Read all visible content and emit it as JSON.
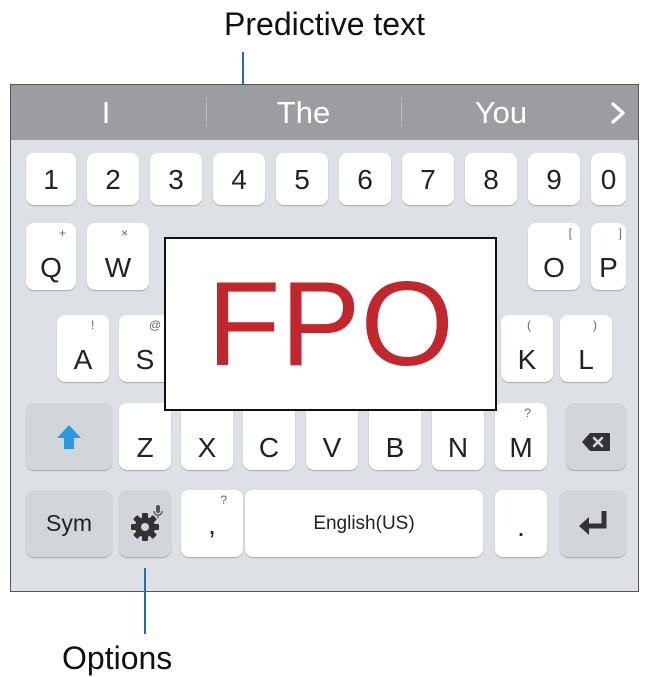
{
  "callouts": {
    "top": "Predictive text",
    "bottom": "Options"
  },
  "suggestions": [
    "I",
    "The",
    "You"
  ],
  "suggestion_more_icon": "chevron-right-icon",
  "number_row": [
    "1",
    "2",
    "3",
    "4",
    "5",
    "6",
    "7",
    "8",
    "9",
    "0"
  ],
  "row1": {
    "keys": [
      {
        "label": "Q",
        "sub": "+"
      },
      {
        "label": "W",
        "sub": "×"
      },
      {
        "label": "O",
        "sub": "["
      },
      {
        "label": "P",
        "sub": "]"
      }
    ]
  },
  "row2": {
    "keys": [
      {
        "label": "A",
        "sub": "!"
      },
      {
        "label": "S",
        "sub": "@"
      },
      {
        "label": "K",
        "sub": "("
      },
      {
        "label": "L",
        "sub": ")"
      }
    ]
  },
  "row3": {
    "shift_icon": "shift-up-arrow-icon",
    "keys": [
      {
        "label": "Z",
        "sub": ""
      },
      {
        "label": "X",
        "sub": ""
      },
      {
        "label": "C",
        "sub": ""
      },
      {
        "label": "V",
        "sub": ""
      },
      {
        "label": "B",
        "sub": ""
      },
      {
        "label": "N",
        "sub": ""
      },
      {
        "label": "M",
        "sub": "?"
      }
    ],
    "backspace_icon": "backspace-icon"
  },
  "bottom_row": {
    "sym": "Sym",
    "settings_icon": "gear-icon",
    "mic_icon": "microphone-icon",
    "comma": ",",
    "comma_sub": "?",
    "space": "English(US)",
    "period": ".",
    "enter_icon": "enter-icon"
  },
  "overlay": "FPO",
  "colors": {
    "accent": "#1f6fb5",
    "fpo": "#c1272d",
    "shift": "#2b9ae0"
  }
}
